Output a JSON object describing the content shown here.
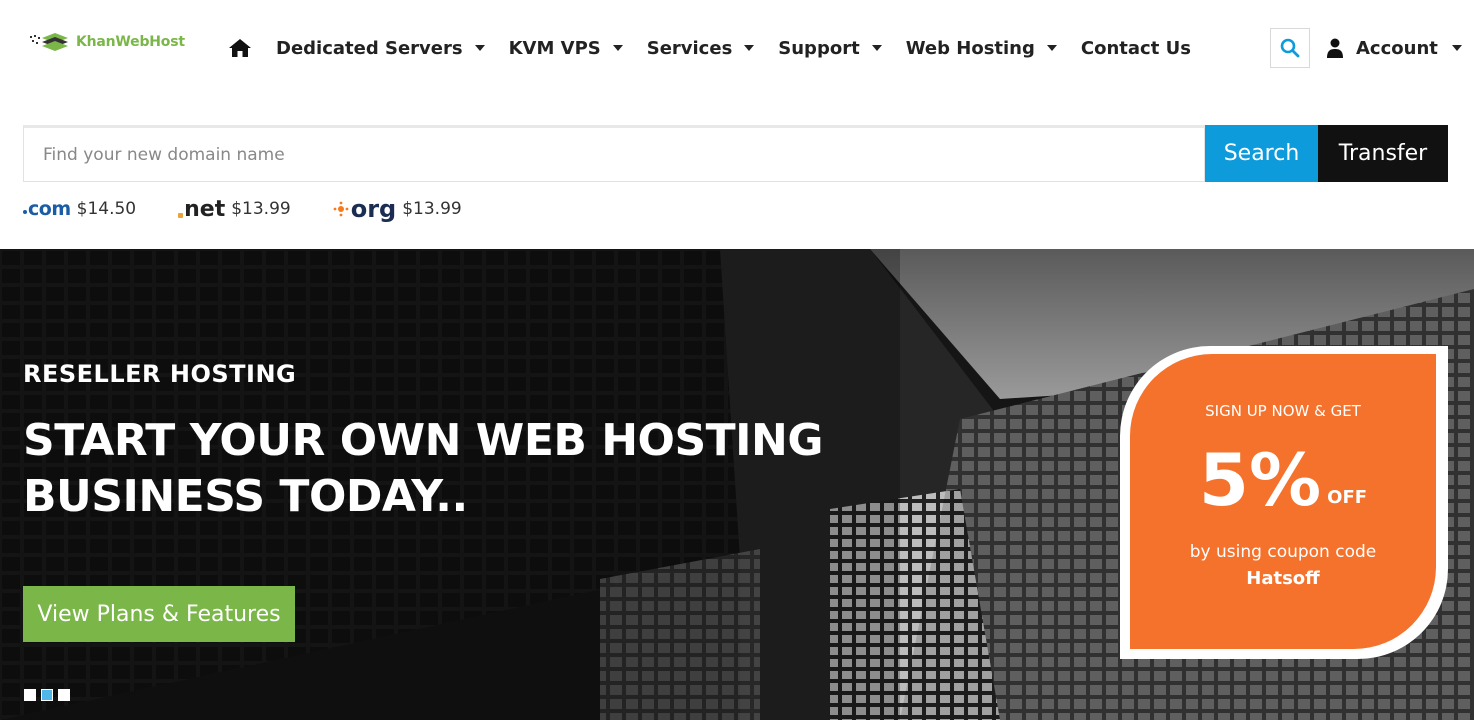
{
  "brand": {
    "name": "KhanWebHost",
    "color": "#7ab648"
  },
  "nav": {
    "items": [
      {
        "label": "Dedicated Servers",
        "has_dropdown": true
      },
      {
        "label": "KVM VPS",
        "has_dropdown": true
      },
      {
        "label": "Services",
        "has_dropdown": true
      },
      {
        "label": "Support",
        "has_dropdown": true
      },
      {
        "label": "Web Hosting",
        "has_dropdown": true
      },
      {
        "label": "Contact Us",
        "has_dropdown": false
      }
    ],
    "home_icon": "home-icon",
    "search_icon": "search-icon",
    "account_label": "Account",
    "account_icon": "user-icon"
  },
  "domain_search": {
    "placeholder": "Find your new domain name",
    "value": "",
    "search_label": "Search",
    "transfer_label": "Transfer",
    "search_color": "#0e9bdc",
    "transfer_color": "#111111"
  },
  "tlds": [
    {
      "ext": "com",
      "price": "$14.50"
    },
    {
      "ext": "net",
      "price": "$13.99"
    },
    {
      "ext": "org",
      "price": "$13.99"
    }
  ],
  "hero": {
    "kicker": "RESELLER HOSTING",
    "title": "START YOUR OWN WEB HOSTING BUSINESS TODAY..",
    "cta_label": "View Plans & Features",
    "cta_color": "#7ab648",
    "slides": 3,
    "active_slide": 2
  },
  "promo": {
    "top": "SIGN UP NOW & GET",
    "percent": "5%",
    "off": "OFF",
    "sub": "by using coupon code",
    "code": "Hatsoff",
    "color": "#f4722b"
  }
}
